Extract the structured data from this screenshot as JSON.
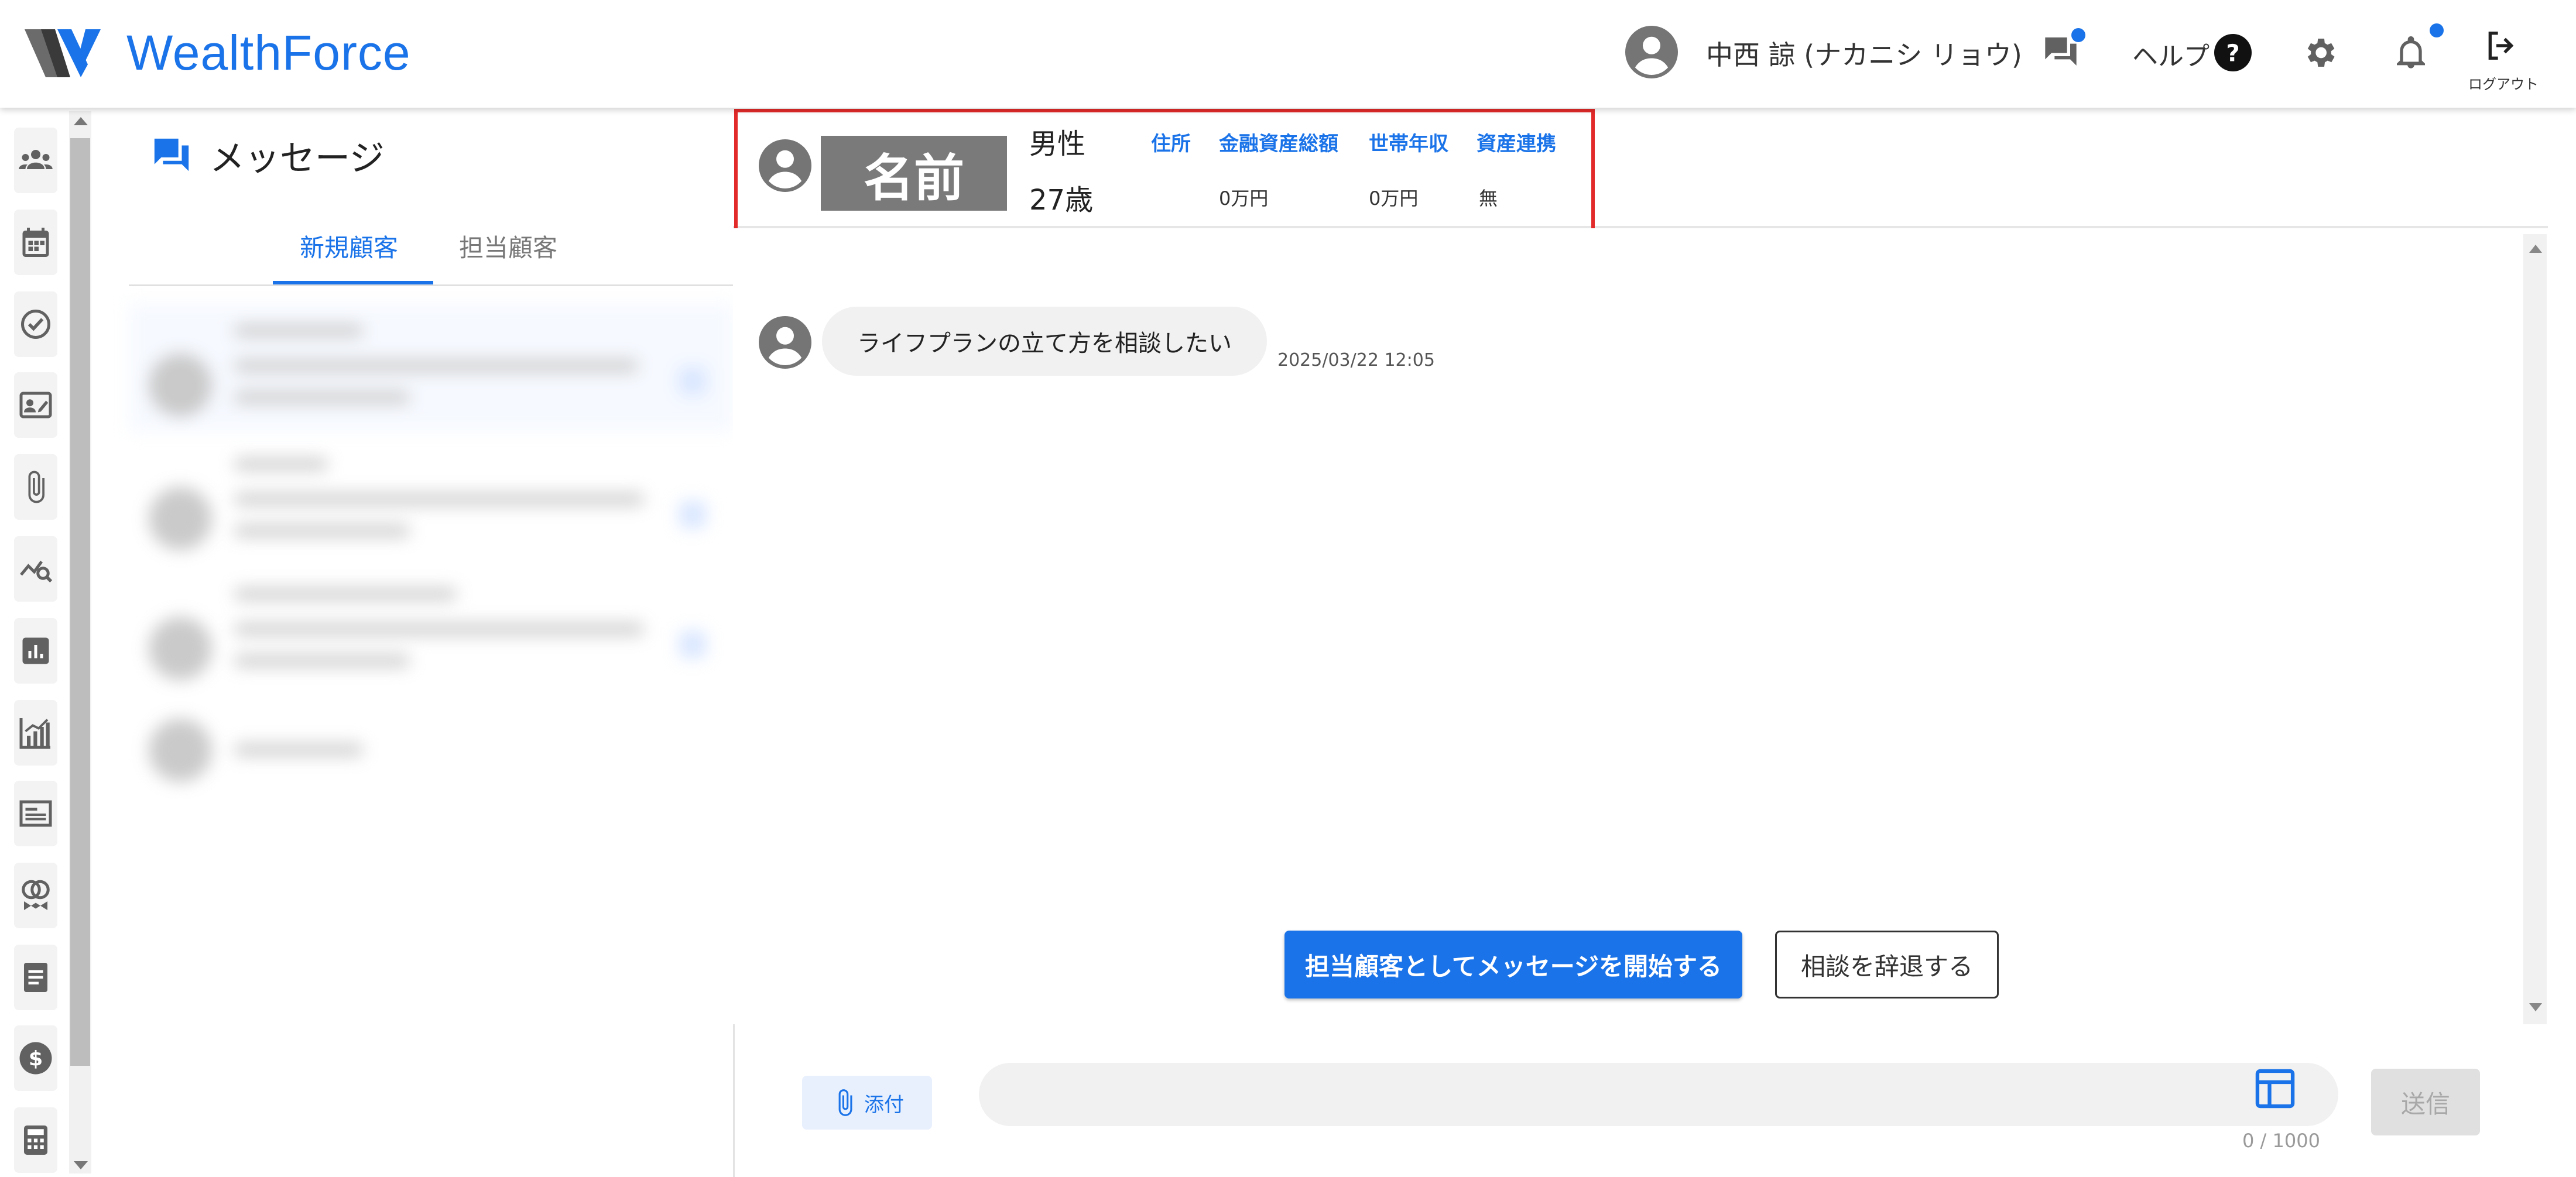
{
  "header": {
    "brand": "WealthForce",
    "user_name": "中西 諒 (ナカニシ リョウ)",
    "help_label": "ヘルプ",
    "logout_label": "ログアウト",
    "accent_color": "#1a73e8"
  },
  "sidebar": {
    "items": [
      {
        "icon": "customers-icon"
      },
      {
        "icon": "calendar-icon"
      },
      {
        "icon": "task-check-icon"
      },
      {
        "icon": "contact-card-icon"
      },
      {
        "icon": "attachment-icon"
      },
      {
        "icon": "analysis-search-icon"
      },
      {
        "icon": "report-chart-icon"
      },
      {
        "icon": "growth-chart-icon"
      },
      {
        "icon": "article-icon"
      },
      {
        "icon": "insurance-icon"
      },
      {
        "icon": "document-icon"
      },
      {
        "icon": "dollar-icon"
      },
      {
        "icon": "calculator-icon"
      }
    ]
  },
  "messages_panel": {
    "title": "メッセージ",
    "tabs": [
      {
        "label": "新規顧客",
        "active": true
      },
      {
        "label": "担当顧客",
        "active": false
      }
    ]
  },
  "customer": {
    "name": "名前",
    "gender": "男性",
    "age": "27歳",
    "columns": [
      {
        "label": "住所",
        "value": ""
      },
      {
        "label": "金融資産総額",
        "value": "0万円"
      },
      {
        "label": "世帯年収",
        "value": "0万円"
      },
      {
        "label": "資産連携",
        "value": "無"
      }
    ]
  },
  "chat": {
    "messages": [
      {
        "text": "ライフプランの立て方を相談したい",
        "time": "2025/03/22 12:05"
      }
    ],
    "start_button": "担当顧客としてメッセージを開始する",
    "decline_button": "相談を辞退する"
  },
  "composer": {
    "attach_label": "添付",
    "input_value": "",
    "char_count": "0 / 1000",
    "send_label": "送信"
  }
}
